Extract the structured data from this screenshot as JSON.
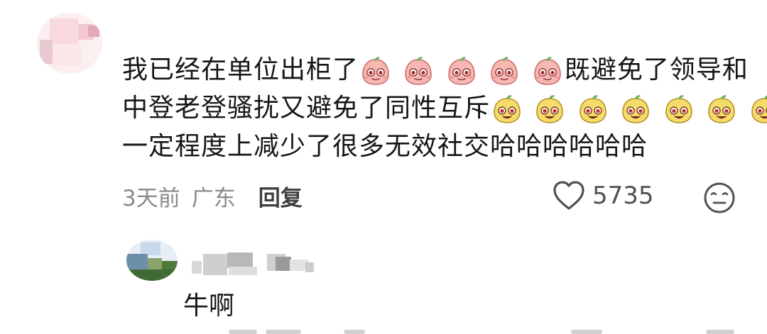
{
  "comment": {
    "lines": [
      {
        "text": "我已经在单位出柜了",
        "emoji": {
          "name": "pink-peach-emoji",
          "count": 5
        },
        "after": "既避免了领导和"
      },
      {
        "text": "中登老登骚扰又避免了同性互斥",
        "emoji": {
          "name": "yellow-face-emoji",
          "count": 7
        },
        "after": ""
      },
      {
        "text": "一定程度上减少了很多无效社交哈哈哈哈哈哈",
        "emoji": null,
        "after": ""
      }
    ],
    "time": "3天前",
    "location": "广东",
    "reply_label": "回复",
    "like_count": "5735",
    "icons": {
      "like": "heart-icon",
      "dislike": "neutral-face-icon"
    }
  },
  "reply": {
    "text": "牛啊"
  },
  "colors": {
    "text": "#161616",
    "meta": "#8a8a8a",
    "icon": "#505050"
  }
}
